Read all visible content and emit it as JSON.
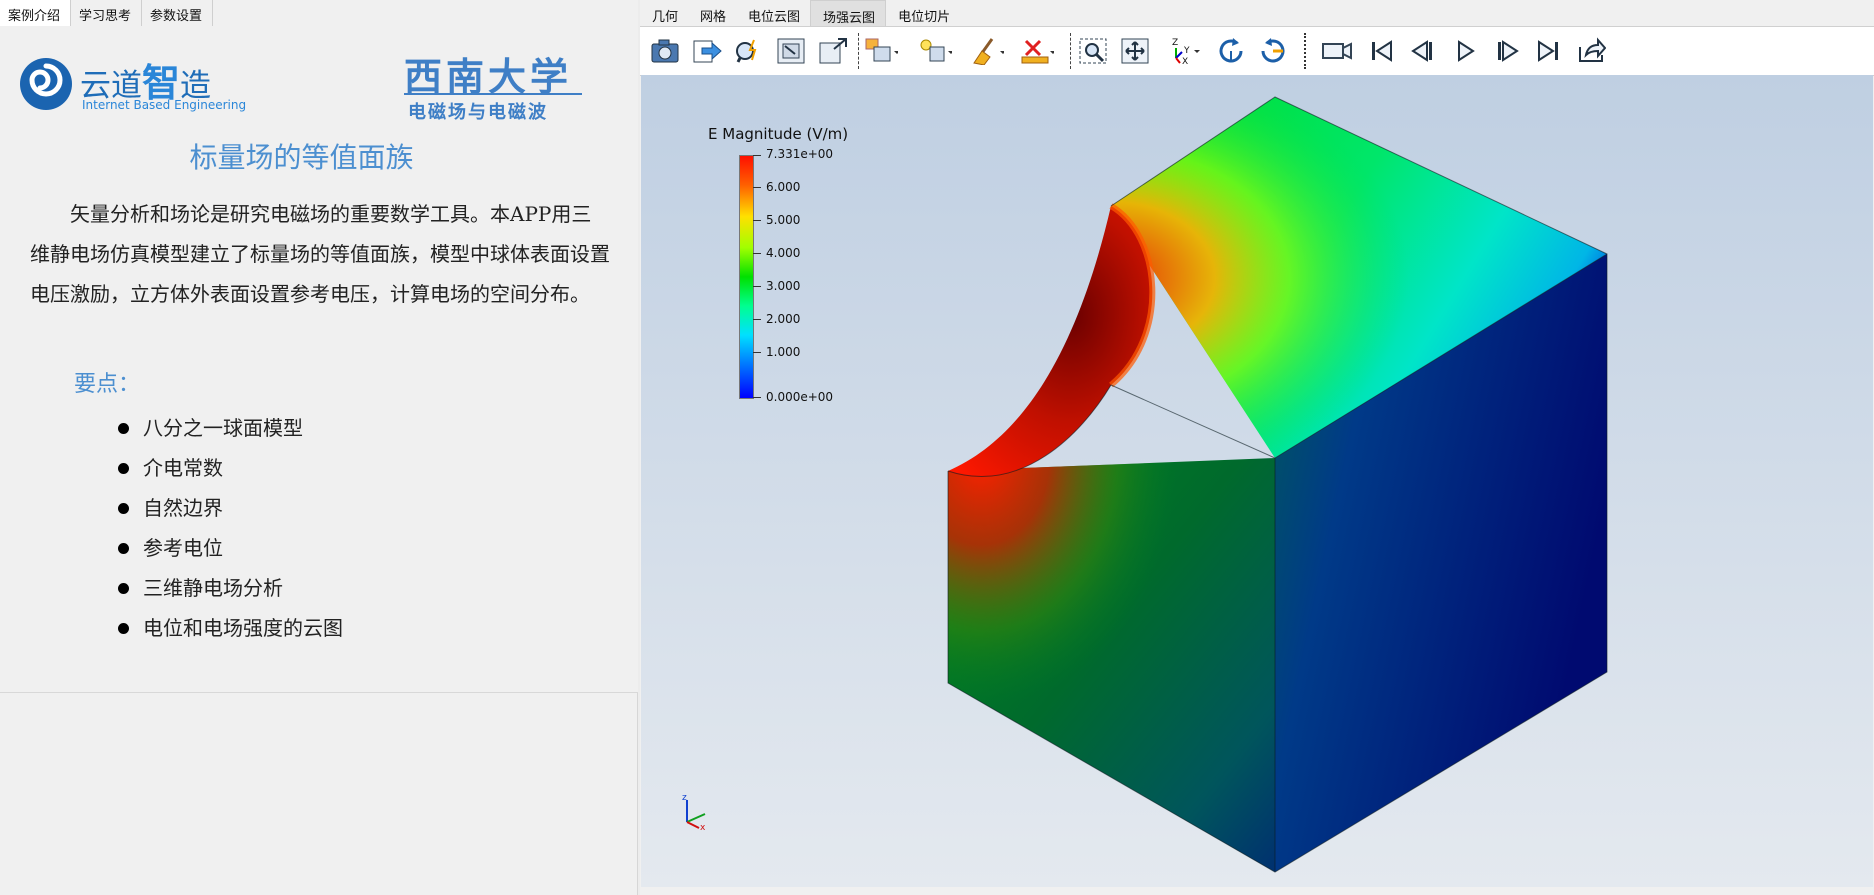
{
  "left_tabs": [
    {
      "label": "案例介绍"
    },
    {
      "label": "学习思考"
    },
    {
      "label": "参数设置"
    }
  ],
  "logo_left": {
    "name_part1": "云道",
    "name_part2": "智",
    "name_part3": "造",
    "tagline": "Internet Based Engineering"
  },
  "logo_right": {
    "name": "西南大学",
    "subtitle": "电磁场与电磁波"
  },
  "title": "标量场的等值面族",
  "intro": "矢量分析和场论是研究电磁场的重要数学工具。本APP用三维静电场仿真模型建立了标量场的等值面族，模型中球体表面设置电压激励，立方体外表面设置参考电压，计算电场的空间分布。",
  "keys_title": "要点：",
  "keys": [
    "八分之一球面模型",
    "介电常数",
    "自然边界",
    "参考电位",
    "三维静电场分析",
    "电位和电场强度的云图"
  ],
  "right_tabs": [
    {
      "label": "几何",
      "active": false
    },
    {
      "label": "网格",
      "active": false
    },
    {
      "label": "电位云图",
      "active": false
    },
    {
      "label": "场强云图",
      "active": true
    },
    {
      "label": "电位切片",
      "active": false
    }
  ],
  "toolbar": [
    {
      "name": "screenshot-icon"
    },
    {
      "name": "export-icon"
    },
    {
      "name": "query-icon"
    },
    {
      "name": "fit-view-icon"
    },
    {
      "name": "reset-view-icon"
    },
    {
      "name": "box-select-icon"
    },
    {
      "name": "light-icon"
    },
    {
      "name": "clear-icon"
    },
    {
      "name": "delete-measure-icon"
    },
    {
      "name": "zoom-box-icon"
    },
    {
      "name": "pan-icon"
    },
    {
      "name": "axes-orient-icon"
    },
    {
      "name": "rotate-cw-icon"
    },
    {
      "name": "rotate-ccw-icon"
    },
    {
      "name": "camera-icon"
    },
    {
      "name": "first-frame-icon"
    },
    {
      "name": "prev-frame-icon"
    },
    {
      "name": "play-icon"
    },
    {
      "name": "next-frame-icon"
    },
    {
      "name": "last-frame-icon"
    },
    {
      "name": "export-animation-icon"
    }
  ],
  "legend": {
    "title": "E Magnitude (V/m)",
    "max": "7.331e+00",
    "ticks": [
      "6.000",
      "5.000",
      "4.000",
      "3.000",
      "2.000",
      "1.000"
    ],
    "min": "0.000e+00"
  },
  "axes_labels": {
    "z": "z",
    "x": "x"
  }
}
